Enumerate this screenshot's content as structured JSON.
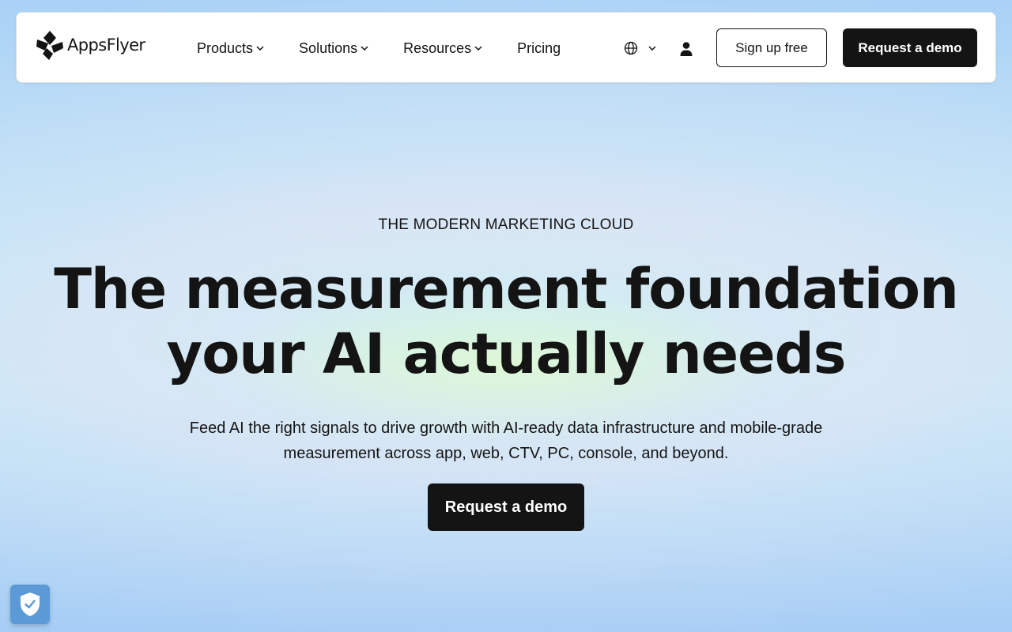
{
  "header": {
    "logo_text": "AppsFlyer",
    "menu": [
      {
        "label": "Products",
        "has_dropdown": true
      },
      {
        "label": "Solutions",
        "has_dropdown": true
      },
      {
        "label": "Resources",
        "has_dropdown": true
      },
      {
        "label": "Pricing",
        "has_dropdown": false
      }
    ],
    "language_icon": "globe-icon",
    "account_icon": "user-icon",
    "signup_label": "Sign up free",
    "demo_label": "Request a demo"
  },
  "hero": {
    "eyebrow": "THE MODERN MARKETING CLOUD",
    "headline_line1": "The measurement foundation",
    "headline_line2": "your AI actually needs",
    "subtext_line1": "Feed AI the right signals to drive growth with AI-ready data infrastructure and mobile-grade",
    "subtext_line2": "measurement across app, web, CTV, PC, console, and beyond.",
    "cta_label": "Request a demo"
  },
  "privacy_widget": {
    "icon": "shield-check-icon"
  },
  "colors": {
    "text": "#141414",
    "button_dark": "#141414",
    "privacy_badge": "#5b9ad6"
  }
}
